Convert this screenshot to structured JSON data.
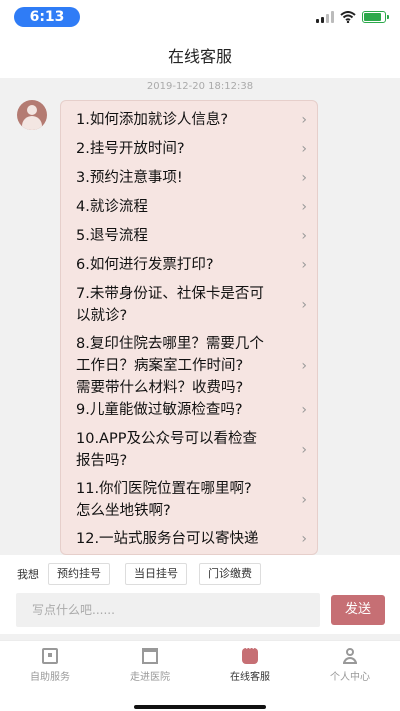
{
  "status_bar": {
    "time": "6:13"
  },
  "header": {
    "title": "在线客服"
  },
  "chat": {
    "timestamp": "2019-12-20 18:12:38",
    "faq_items": [
      {
        "lines": [
          "1.如何添加就诊人信息?"
        ]
      },
      {
        "lines": [
          "2.挂号开放时间?"
        ]
      },
      {
        "lines": [
          "3.预约注意事项!"
        ]
      },
      {
        "lines": [
          "4.就诊流程"
        ]
      },
      {
        "lines": [
          "5.退号流程"
        ]
      },
      {
        "lines": [
          "6.如何进行发票打印?"
        ]
      },
      {
        "lines": [
          "7.未带身份证、社保卡是否可",
          "以就诊?"
        ]
      },
      {
        "lines": [
          "8.复印住院去哪里？需要几个",
          "工作日？病案室工作时间?",
          "需要带什么材料？收费吗?"
        ]
      },
      {
        "lines": [
          "9.儿童能做过敏源检查吗?"
        ]
      },
      {
        "lines": [
          "10.APP及公众号可以看检查",
          "报告吗?"
        ]
      },
      {
        "lines": [
          "11.你们医院位置在哪里啊?",
          "怎么坐地铁啊?"
        ]
      },
      {
        "lines": [
          "12.一站式服务台可以寄快递"
        ]
      }
    ]
  },
  "quick_reply": {
    "label": "我想",
    "chips": [
      "预约挂号",
      "当日挂号",
      "门诊缴费"
    ]
  },
  "input": {
    "placeholder": "写点什么吧......",
    "send_label": "发送"
  },
  "tab_bar": {
    "tabs": [
      {
        "label": "自助服务",
        "icon": "monitor-icon"
      },
      {
        "label": "走进医院",
        "icon": "hospital-building-icon"
      },
      {
        "label": "在线客服",
        "icon": "chat-bubble-icon"
      },
      {
        "label": "个人中心",
        "icon": "user-icon"
      }
    ],
    "active_index": 2
  },
  "colors": {
    "accent": "#c66f74",
    "bubble": "#f6e5e2",
    "time_pill": "#2f7cf6"
  }
}
